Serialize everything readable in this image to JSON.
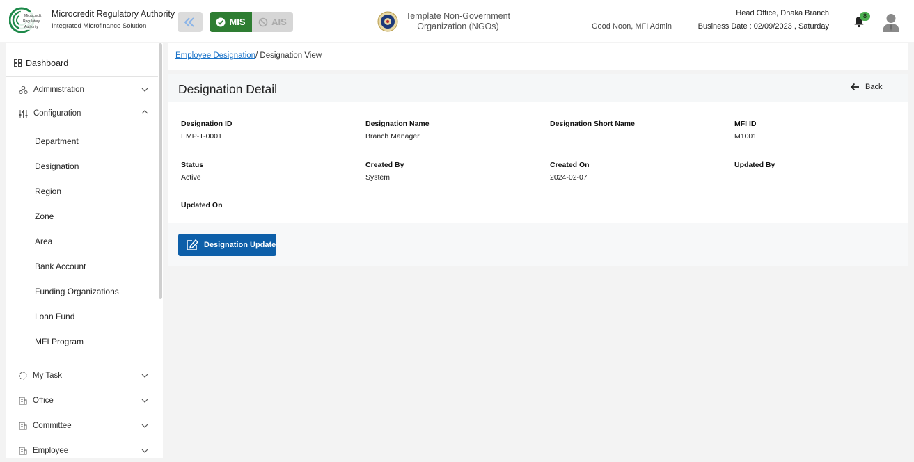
{
  "header": {
    "brand_title": "Microcredit Regulatory Authority",
    "brand_subtitle": "Integrated Microfinance Solution",
    "logo_text": [
      "Microcredit",
      "Regulatory",
      "Authority"
    ],
    "mis_label": "MIS",
    "ais_label": "AIS",
    "org_name_line1": "Template Non-Government",
    "org_name_line2": "Organization (NGOs)",
    "greeting": "Good Noon, MFI Admin",
    "branch": "Head Office, Dhaka Branch",
    "business_date": "Business Date : 02/09/2023 , Saturday",
    "notification_count": "8",
    "colors": {
      "mis_active": "#2e7d32",
      "ais_inactive": "#d6d6d6",
      "badge": "#4caf50"
    }
  },
  "sidebar": {
    "dashboard": "Dashboard",
    "administration": "Administration",
    "configuration": "Configuration",
    "config_items": [
      "Department",
      "Designation",
      "Region",
      "Zone",
      "Area",
      "Bank Account",
      "Funding Organizations",
      "Loan Fund",
      "MFI Program"
    ],
    "my_task": "My Task",
    "office": "Office",
    "committee": "Committee",
    "employee": "Employee"
  },
  "breadcrumb": {
    "link": "Employee Designation",
    "separator": "/",
    "current": "Designation View"
  },
  "detail": {
    "title": "Designation Detail",
    "back_label": "Back",
    "fields": {
      "designation_id": {
        "label": "Designation ID",
        "value": "EMP-T-0001"
      },
      "designation_name": {
        "label": "Designation Name",
        "value": "Branch Manager"
      },
      "designation_short_name": {
        "label": "Designation Short Name",
        "value": ""
      },
      "mfi_id": {
        "label": "MFI ID",
        "value": "M1001"
      },
      "status": {
        "label": "Status",
        "value": "Active"
      },
      "created_by": {
        "label": "Created By",
        "value": "System"
      },
      "created_on": {
        "label": "Created On",
        "value": "2024-02-07"
      },
      "updated_by": {
        "label": "Updated By",
        "value": ""
      },
      "updated_on": {
        "label": "Updated On",
        "value": ""
      }
    },
    "update_button": "Designation Update",
    "colors": {
      "primary": "#0d5fa9",
      "link": "#1a73c9"
    }
  }
}
